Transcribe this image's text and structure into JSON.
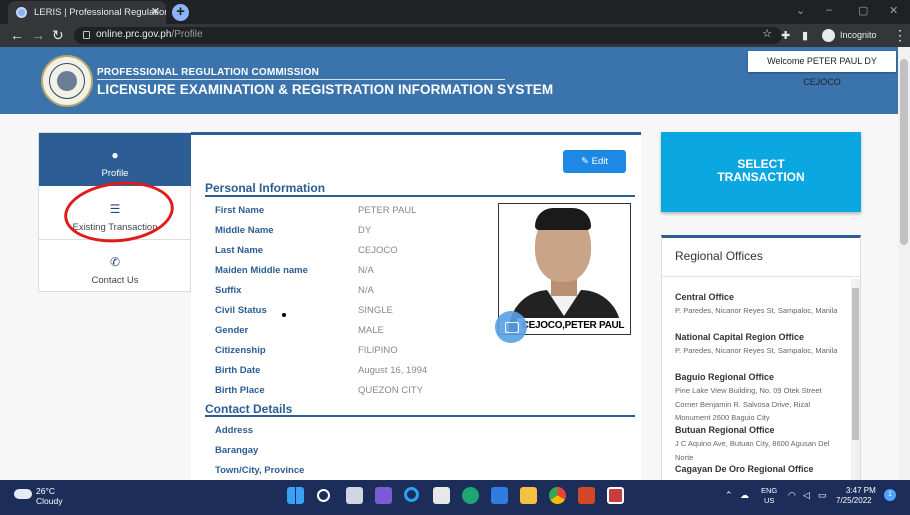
{
  "browser": {
    "tab_title": "LERIS | Professional Regulation C",
    "url_host": "online.prc.gov.ph",
    "url_path": "/Profile",
    "incognito_label": "Incognito"
  },
  "header": {
    "org": "PROFESSIONAL REGULATION COMMISSION",
    "system": "LICENSURE EXAMINATION & REGISTRATION INFORMATION SYSTEM",
    "welcome": "Welcome PETER PAUL DY CEJOCO"
  },
  "nav": {
    "profile": "Profile",
    "existing": "Existing Transaction",
    "contact": "Contact Us"
  },
  "edit_label": "Edit",
  "personal": {
    "title": "Personal Information",
    "fields": [
      {
        "label": "First Name",
        "value": "PETER PAUL"
      },
      {
        "label": "Middle Name",
        "value": "DY"
      },
      {
        "label": "Last Name",
        "value": "CEJOCO"
      },
      {
        "label": "Maiden Middle name",
        "value": "N/A"
      },
      {
        "label": "Suffix",
        "value": "N/A"
      },
      {
        "label": "Civil Status",
        "value": "SINGLE"
      },
      {
        "label": "Gender",
        "value": "MALE"
      },
      {
        "label": "Citizenship",
        "value": "FILIPINO"
      },
      {
        "label": "Birth Date",
        "value": "August 16, 1994"
      },
      {
        "label": "Birth Place",
        "value": "QUEZON CITY"
      }
    ],
    "photo_caption": "CEJOCO,PETER PAUL DY"
  },
  "contact": {
    "title": "Contact Details",
    "fields": [
      {
        "label": "Address",
        "value": ""
      },
      {
        "label": "Barangay",
        "value": ""
      },
      {
        "label": "Town/City, Province",
        "value": ""
      }
    ]
  },
  "select_transaction": {
    "line1": "SELECT",
    "line2": "TRANSACTION"
  },
  "regional": {
    "title": "Regional Offices",
    "offices": [
      {
        "name": "Central Office",
        "address": "P. Paredes, Nicanor Reyes St, Sampaloc, Manila"
      },
      {
        "name": "National Capital Region Office",
        "address": "P. Paredes, Nicanor Reyes St, Sampaloc, Manila"
      },
      {
        "name": "Baguio Regional Office",
        "address": "Pine Lake View Building, No. 09 Otek Street Corner Benjamin R. Salvosa Drive, Rizal Monument 2600 Baguio City"
      },
      {
        "name": "Butuan Regional Office",
        "address": "J C Aquino Ave, Butuan City, 8600 Agusan Del Norte"
      },
      {
        "name": "Cagayan De Oro Regional Office",
        "address": ""
      }
    ]
  },
  "taskbar": {
    "temp": "26°C",
    "weather": "Cloudy",
    "lang1": "ENG",
    "lang2": "US",
    "time": "3:47 PM",
    "date": "7/25/2022",
    "notif_count": "1"
  }
}
